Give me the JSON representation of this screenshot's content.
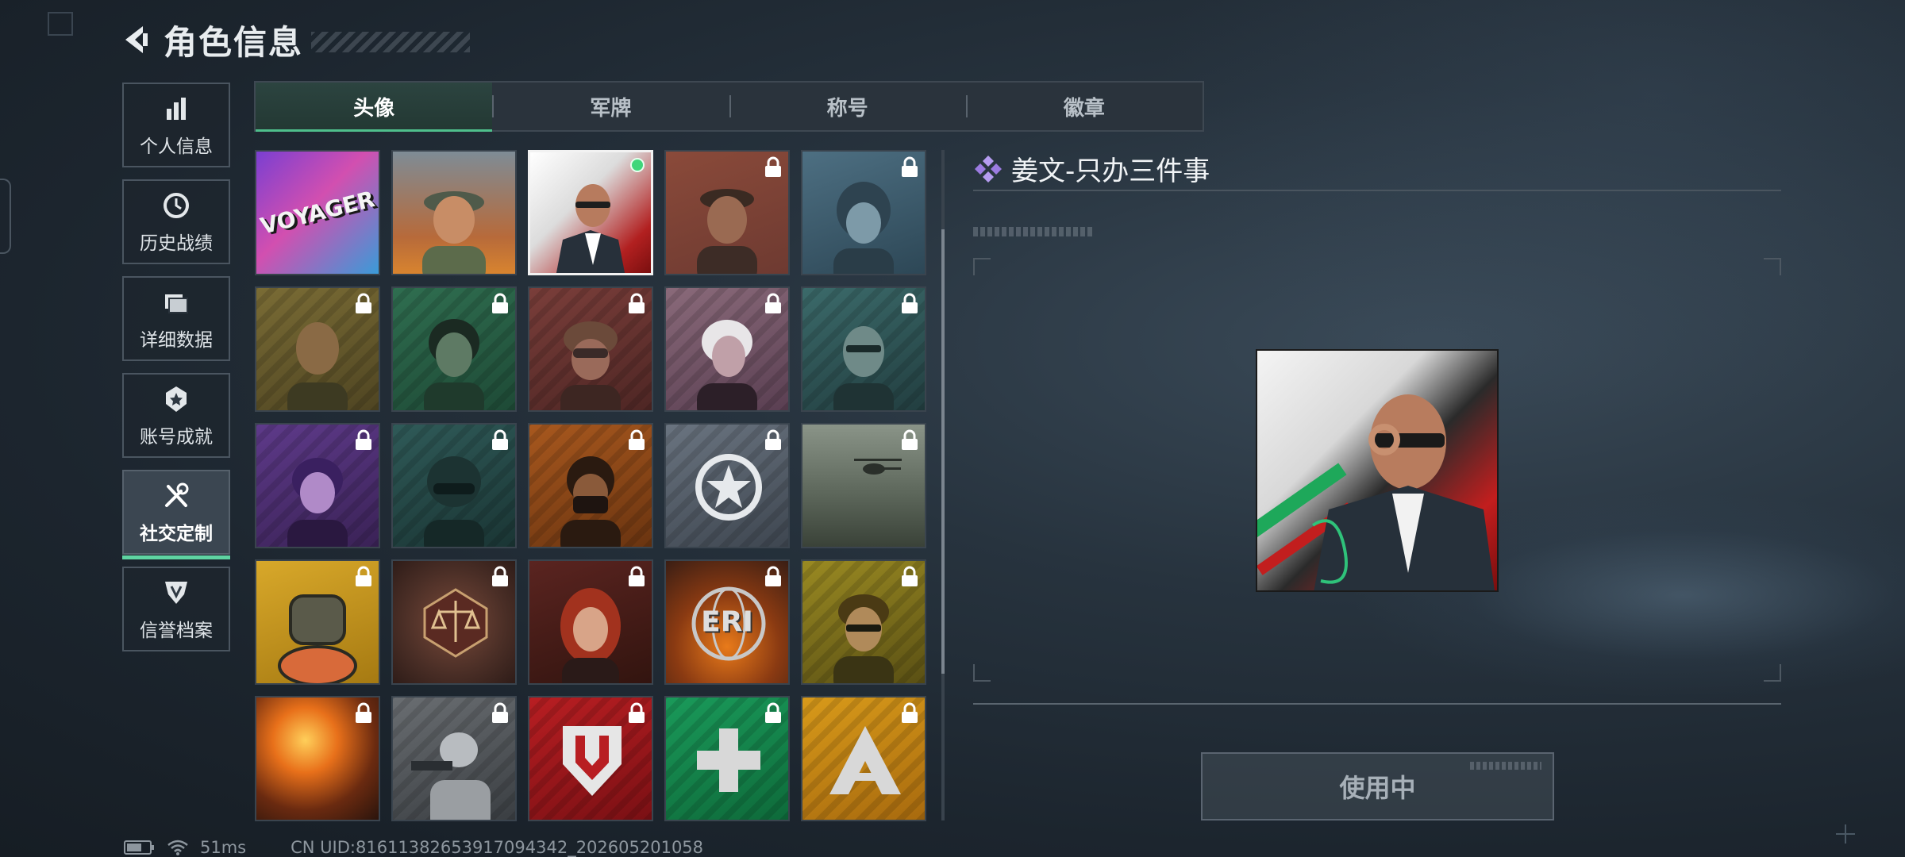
{
  "header": {
    "title": "角色信息"
  },
  "side_nav": [
    {
      "label": "个人信息",
      "icon": "bar-chart-icon",
      "active": false
    },
    {
      "label": "历史战绩",
      "icon": "history-clock-icon",
      "active": false
    },
    {
      "label": "详细数据",
      "icon": "folder-icon",
      "active": false
    },
    {
      "label": "账号成就",
      "icon": "achievement-badge-icon",
      "active": false
    },
    {
      "label": "社交定制",
      "icon": "tools-icon",
      "active": true
    },
    {
      "label": "信誉档案",
      "icon": "reputation-shield-icon",
      "active": false
    }
  ],
  "tabs": [
    {
      "label": "头像",
      "active": true
    },
    {
      "label": "军牌",
      "active": false
    },
    {
      "label": "称号",
      "active": false
    },
    {
      "label": "徽章",
      "active": false
    }
  ],
  "avatars": [
    {
      "name": "voyager",
      "text": "VOYAGER",
      "locked": false
    },
    {
      "name": "soldier-cap",
      "locked": false
    },
    {
      "name": "jiang-wen",
      "locked": false,
      "selected": true,
      "equipped": true
    },
    {
      "name": "operator-cap-headset",
      "locked": true
    },
    {
      "name": "pilot-helmet",
      "locked": true
    },
    {
      "name": "bald-headset",
      "locked": true
    },
    {
      "name": "long-hair-headset",
      "locked": true
    },
    {
      "name": "helmet-goggles",
      "locked": true
    },
    {
      "name": "white-hair",
      "locked": true
    },
    {
      "name": "glasses-beard",
      "locked": true
    },
    {
      "name": "purple-girl",
      "locked": true
    },
    {
      "name": "masked-helmet",
      "locked": true
    },
    {
      "name": "face-mask",
      "locked": true
    },
    {
      "name": "star-emblem",
      "locked": true
    },
    {
      "name": "battlefield-helicopter",
      "locked": true
    },
    {
      "name": "robot-ramen",
      "locked": true
    },
    {
      "name": "scales-emblem",
      "locked": true
    },
    {
      "name": "red-hair",
      "locked": true
    },
    {
      "name": "eri-globe",
      "text": "ERI",
      "locked": true
    },
    {
      "name": "curly-glasses",
      "locked": true
    },
    {
      "name": "explosion",
      "locked": true
    },
    {
      "name": "gunner-sketch",
      "locked": true
    },
    {
      "name": "red-shield-logo",
      "locked": true
    },
    {
      "name": "green-cross",
      "locked": true
    },
    {
      "name": "yellow-logo",
      "locked": true
    }
  ],
  "detail": {
    "name": "姜文-只办三件事",
    "button_label": "使用中"
  },
  "status": {
    "latency": "51ms",
    "uid": "CN UID:81611382653917094342_202605201058"
  },
  "colors": {
    "accent_green": "#4fbf8c",
    "equipped_dot": "#3fd67a",
    "diamond_purple": "#9b7be0"
  }
}
